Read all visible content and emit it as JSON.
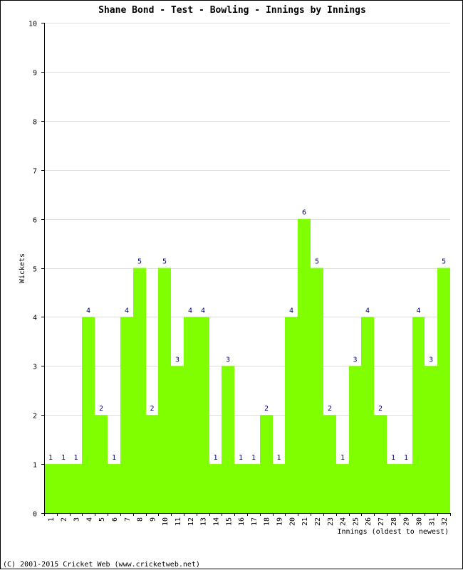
{
  "chart_data": {
    "type": "bar",
    "title": "Shane Bond - Test - Bowling - Innings by Innings",
    "xlabel": "Innings (oldest to newest)",
    "ylabel": "Wickets",
    "ylim": [
      0,
      10
    ],
    "yticks": [
      "0",
      "1",
      "2",
      "3",
      "4",
      "5",
      "6",
      "7",
      "8",
      "9",
      "10"
    ],
    "grid": true,
    "categories": [
      "1",
      "2",
      "3",
      "4",
      "5",
      "6",
      "7",
      "8",
      "9",
      "10",
      "11",
      "12",
      "13",
      "14",
      "15",
      "16",
      "17",
      "18",
      "19",
      "20",
      "21",
      "22",
      "23",
      "24",
      "25",
      "26",
      "27",
      "28",
      "29",
      "30",
      "31",
      "32"
    ],
    "values": [
      1,
      1,
      1,
      4,
      2,
      1,
      4,
      5,
      2,
      5,
      3,
      4,
      4,
      1,
      3,
      1,
      1,
      2,
      1,
      4,
      6,
      5,
      2,
      1,
      3,
      4,
      2,
      1,
      1,
      4,
      3,
      5
    ],
    "data_labels": [
      "1",
      "1",
      "1",
      "4",
      "2",
      "1",
      "4",
      "5",
      "2",
      "5",
      "3",
      "4",
      "4",
      "1",
      "3",
      "1",
      "1",
      "2",
      "1",
      "4",
      "6",
      "5",
      "2",
      "1",
      "3",
      "4",
      "2",
      "1",
      "1",
      "4",
      "3",
      "5"
    ],
    "colors": {
      "bar": "#80ff00",
      "grid": "#dddddd",
      "axis": "#000000",
      "data_label": "#000080"
    }
  },
  "footer": "(C) 2001-2015 Cricket Web (www.cricketweb.net)"
}
